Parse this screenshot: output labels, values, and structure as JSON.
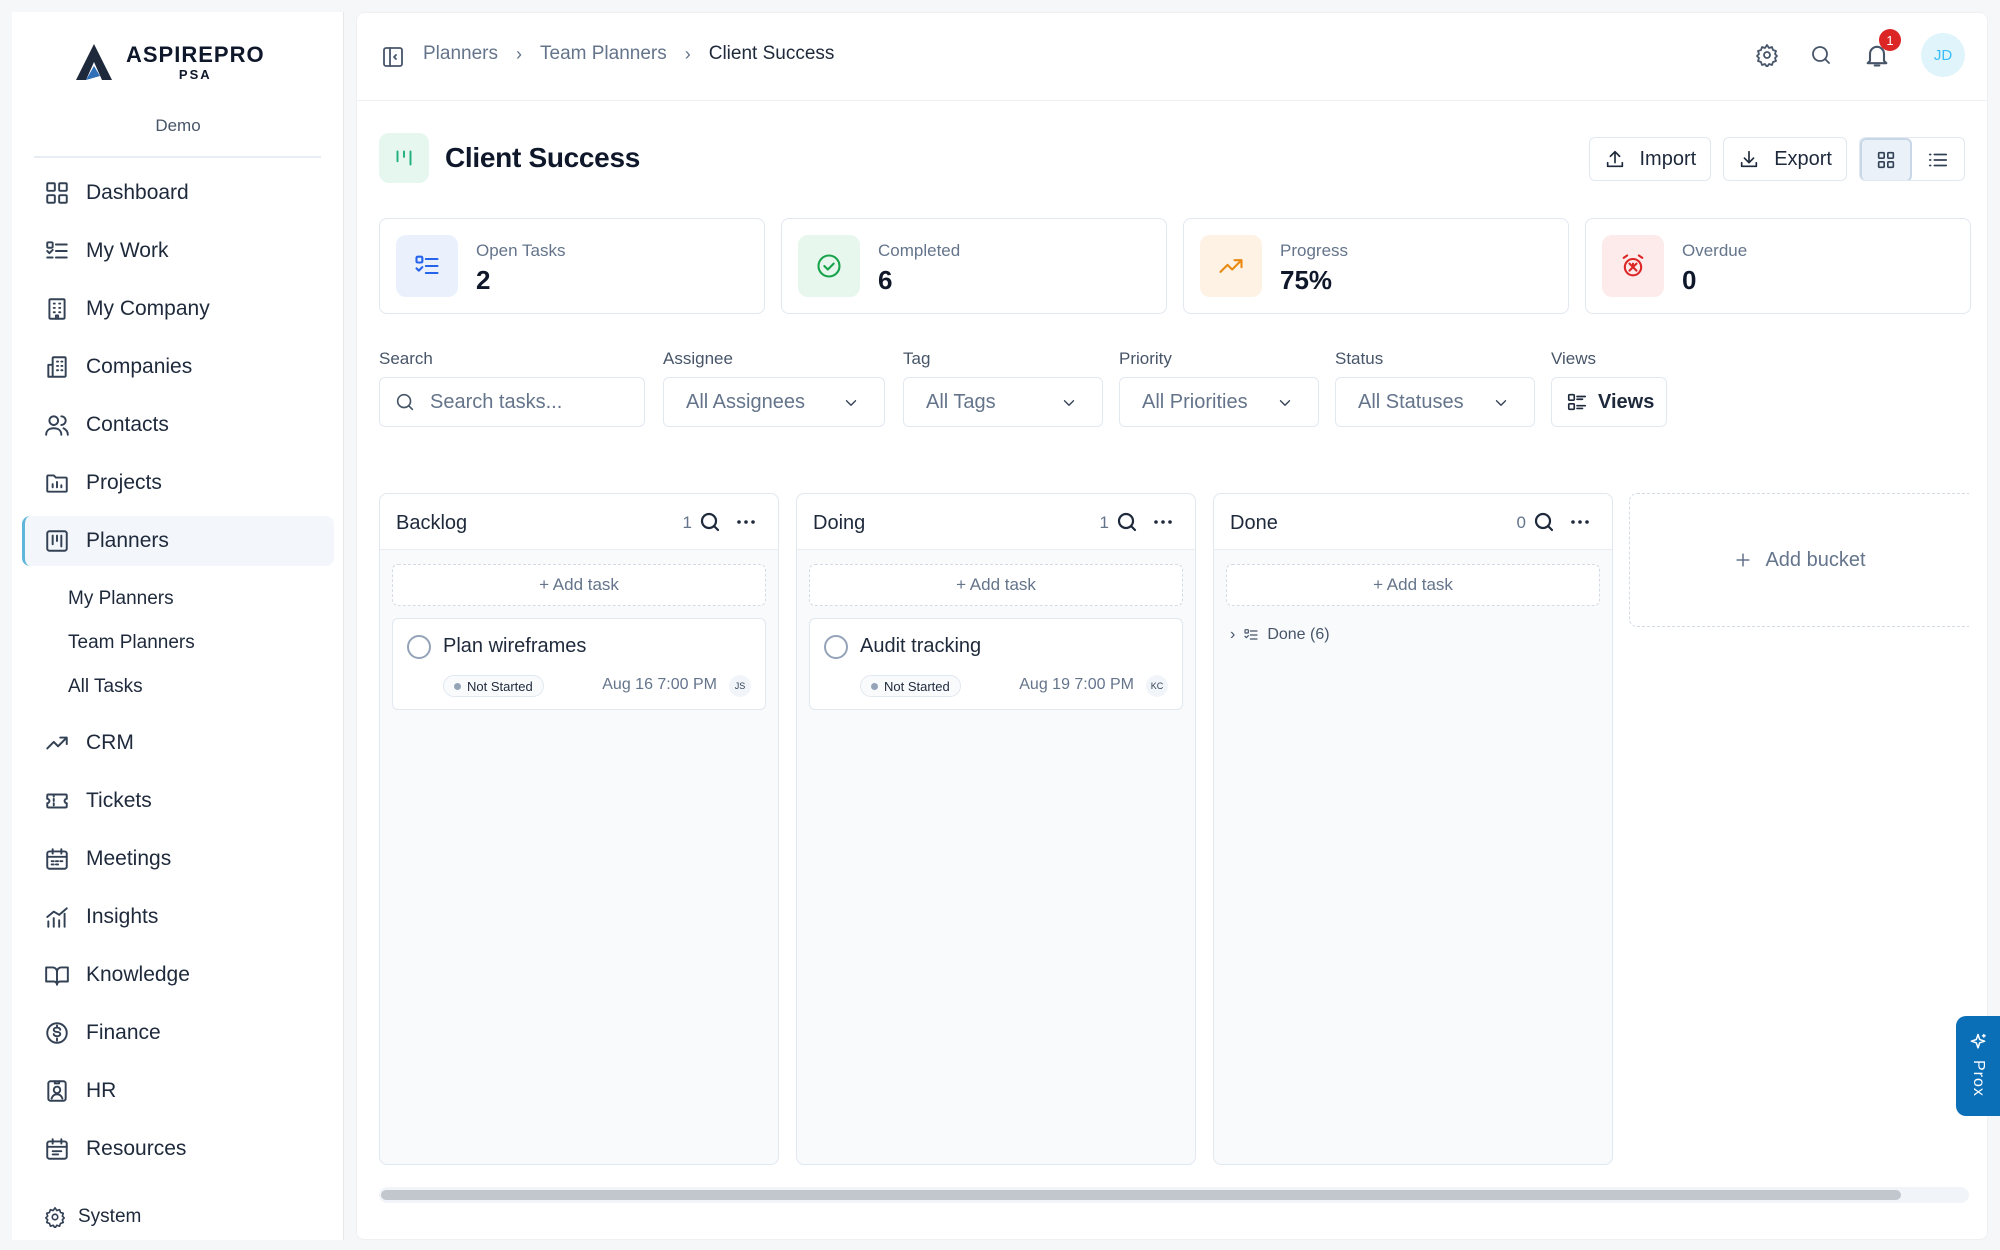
{
  "brand": {
    "name": "ASPIREPRO",
    "sub": "PSA",
    "org": "Demo"
  },
  "sidebar": {
    "items": [
      {
        "label": "Dashboard",
        "icon": "grid-icon"
      },
      {
        "label": "My Work",
        "icon": "list-check-icon"
      },
      {
        "label": "My Company",
        "icon": "building-icon"
      },
      {
        "label": "Companies",
        "icon": "buildings-icon"
      },
      {
        "label": "Contacts",
        "icon": "users-icon"
      },
      {
        "label": "Projects",
        "icon": "folder-chart-icon"
      },
      {
        "label": "Planners",
        "icon": "kanban-icon",
        "active": true
      },
      {
        "label": "CRM",
        "icon": "trending-up-icon"
      },
      {
        "label": "Tickets",
        "icon": "ticket-icon"
      },
      {
        "label": "Meetings",
        "icon": "calendar-icon"
      },
      {
        "label": "Insights",
        "icon": "bar-chart-icon"
      },
      {
        "label": "Knowledge",
        "icon": "book-icon"
      },
      {
        "label": "Finance",
        "icon": "dollar-icon"
      },
      {
        "label": "HR",
        "icon": "id-badge-icon"
      },
      {
        "label": "Resources",
        "icon": "calendar-grid-icon"
      }
    ],
    "sub_items": [
      "My Planners",
      "Team Planners",
      "All Tasks"
    ],
    "footer": {
      "label": "System",
      "icon": "gear-icon"
    }
  },
  "breadcrumb": [
    "Planners",
    "Team Planners",
    "Client Success"
  ],
  "header": {
    "notifications": "1",
    "avatar": "JD"
  },
  "page": {
    "title": "Client Success",
    "import_label": "Import",
    "export_label": "Export"
  },
  "stats": [
    {
      "label": "Open Tasks",
      "value": "2",
      "color": "#2563eb",
      "bg": "#eaf1fd"
    },
    {
      "label": "Completed",
      "value": "6",
      "color": "#16a34a",
      "bg": "#e8f7ee"
    },
    {
      "label": "Progress",
      "value": "75%",
      "color": "#ea8a12",
      "bg": "#fdf2e4"
    },
    {
      "label": "Overdue",
      "value": "0",
      "color": "#dc2626",
      "bg": "#fdeaea"
    }
  ],
  "filters": {
    "search": {
      "label": "Search",
      "placeholder": "Search tasks..."
    },
    "assignee": {
      "label": "Assignee",
      "value": "All Assignees"
    },
    "tag": {
      "label": "Tag",
      "value": "All Tags"
    },
    "priority": {
      "label": "Priority",
      "value": "All Priorities"
    },
    "status": {
      "label": "Status",
      "value": "All Statuses"
    },
    "views": {
      "label": "Views",
      "value": "Views"
    }
  },
  "buckets": [
    {
      "title": "Backlog",
      "count": "1",
      "add_label": "+ Add task",
      "task": {
        "title": "Plan wireframes",
        "status": "Not Started",
        "due": "Aug 16 7:00 PM",
        "assignee": "JS"
      }
    },
    {
      "title": "Doing",
      "count": "1",
      "add_label": "+ Add task",
      "task": {
        "title": "Audit tracking",
        "status": "Not Started",
        "due": "Aug 19 7:00 PM",
        "assignee": "KC"
      }
    },
    {
      "title": "Done",
      "count": "0",
      "add_label": "+ Add task",
      "done_toggle": "Done (6)"
    }
  ],
  "add_bucket_label": "Add bucket",
  "ai_tab": "Prox"
}
